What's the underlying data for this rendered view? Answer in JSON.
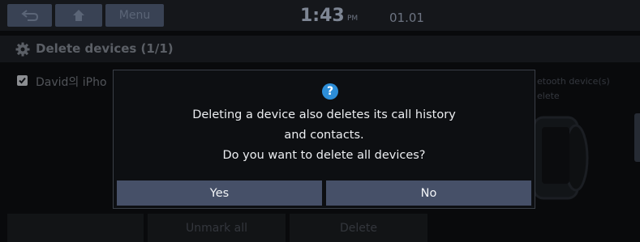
{
  "status_bar": {
    "back_icon": "back-arrow-icon",
    "home_icon": "home-icon",
    "menu_label": "Menu",
    "time": "1:43",
    "ampm": "PM",
    "date": "01.01"
  },
  "header": {
    "icon": "gear-icon",
    "title": "Delete devices (1/1)"
  },
  "device_list": {
    "items": [
      {
        "name": "David의 iPho",
        "checked": true
      }
    ],
    "hint_line1": "etooth device(s)",
    "hint_line2": "elete"
  },
  "bottom_bar": {
    "mark_all_label": "",
    "unmark_all_label": "Unmark all",
    "delete_label": "Delete"
  },
  "dialog": {
    "icon": "question-icon",
    "icon_text": "?",
    "line1": "Deleting a device also deletes its call history",
    "line2": "and contacts.",
    "line3": "Do you want to delete all devices?",
    "yes_label": "Yes",
    "no_label": "No"
  },
  "colors": {
    "dialog_button": "#465068",
    "question_icon": "#2d8ed8",
    "top_button": "#394254"
  }
}
